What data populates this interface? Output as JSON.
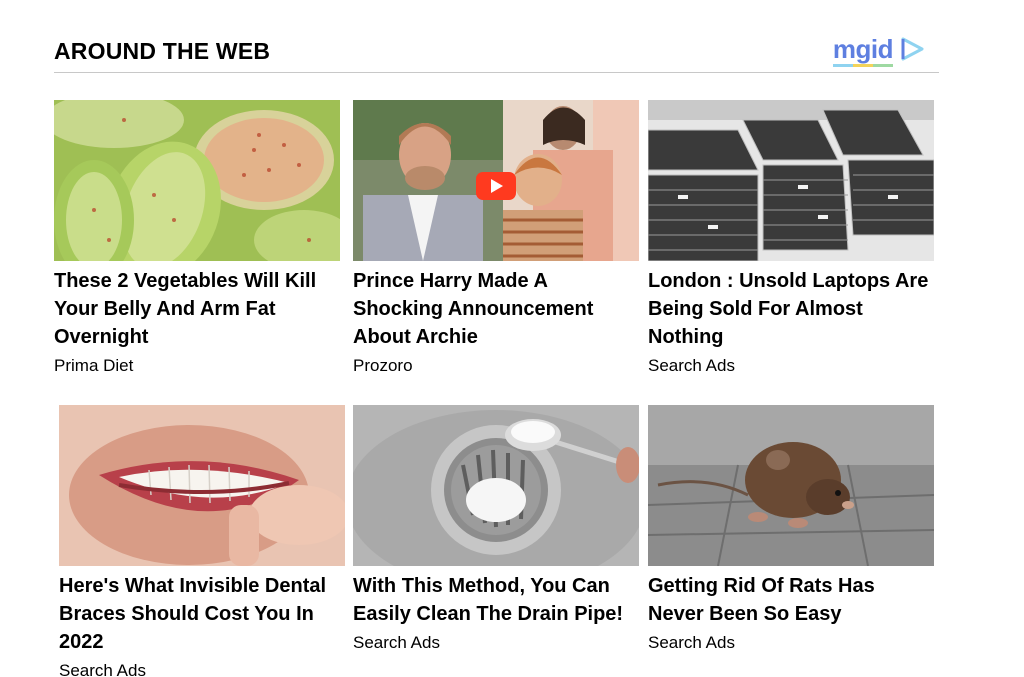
{
  "widget": {
    "title": "AROUND THE WEB",
    "brand": "mgid",
    "brand_icon": "play-triangle-icon",
    "brand_colors": [
      "#5e7fe0",
      "#8fd3f0",
      "#f3d35a",
      "#9ed9a2"
    ]
  },
  "cards": [
    {
      "headline": "These 2 Vegetables Will Kill Your Belly And Arm Fat Overnight",
      "source": "Prima Diet",
      "image": "sliced-cucumber-with-spices"
    },
    {
      "headline": "Prince Harry Made A Shocking Announcement About Archie",
      "source": "Prozoro",
      "image": "man-woman-child-video",
      "has_play": true
    },
    {
      "headline": "London : Unsold Laptops Are Being Sold For Almost Nothing",
      "source": "Search Ads",
      "image": "stacks-of-laptops"
    },
    {
      "headline": "Here's What Invisible Dental Braces Should Cost You In 2022",
      "source": "Search Ads",
      "image": "smile-with-clear-aligner"
    },
    {
      "headline": "With This Method, You Can Easily Clean The Drain Pipe!",
      "source": "Search Ads",
      "image": "baking-soda-on-sink-drain"
    },
    {
      "headline": "Getting Rid Of Rats Has Never Been So Easy",
      "source": "Search Ads",
      "image": "rat-on-pavement"
    }
  ]
}
